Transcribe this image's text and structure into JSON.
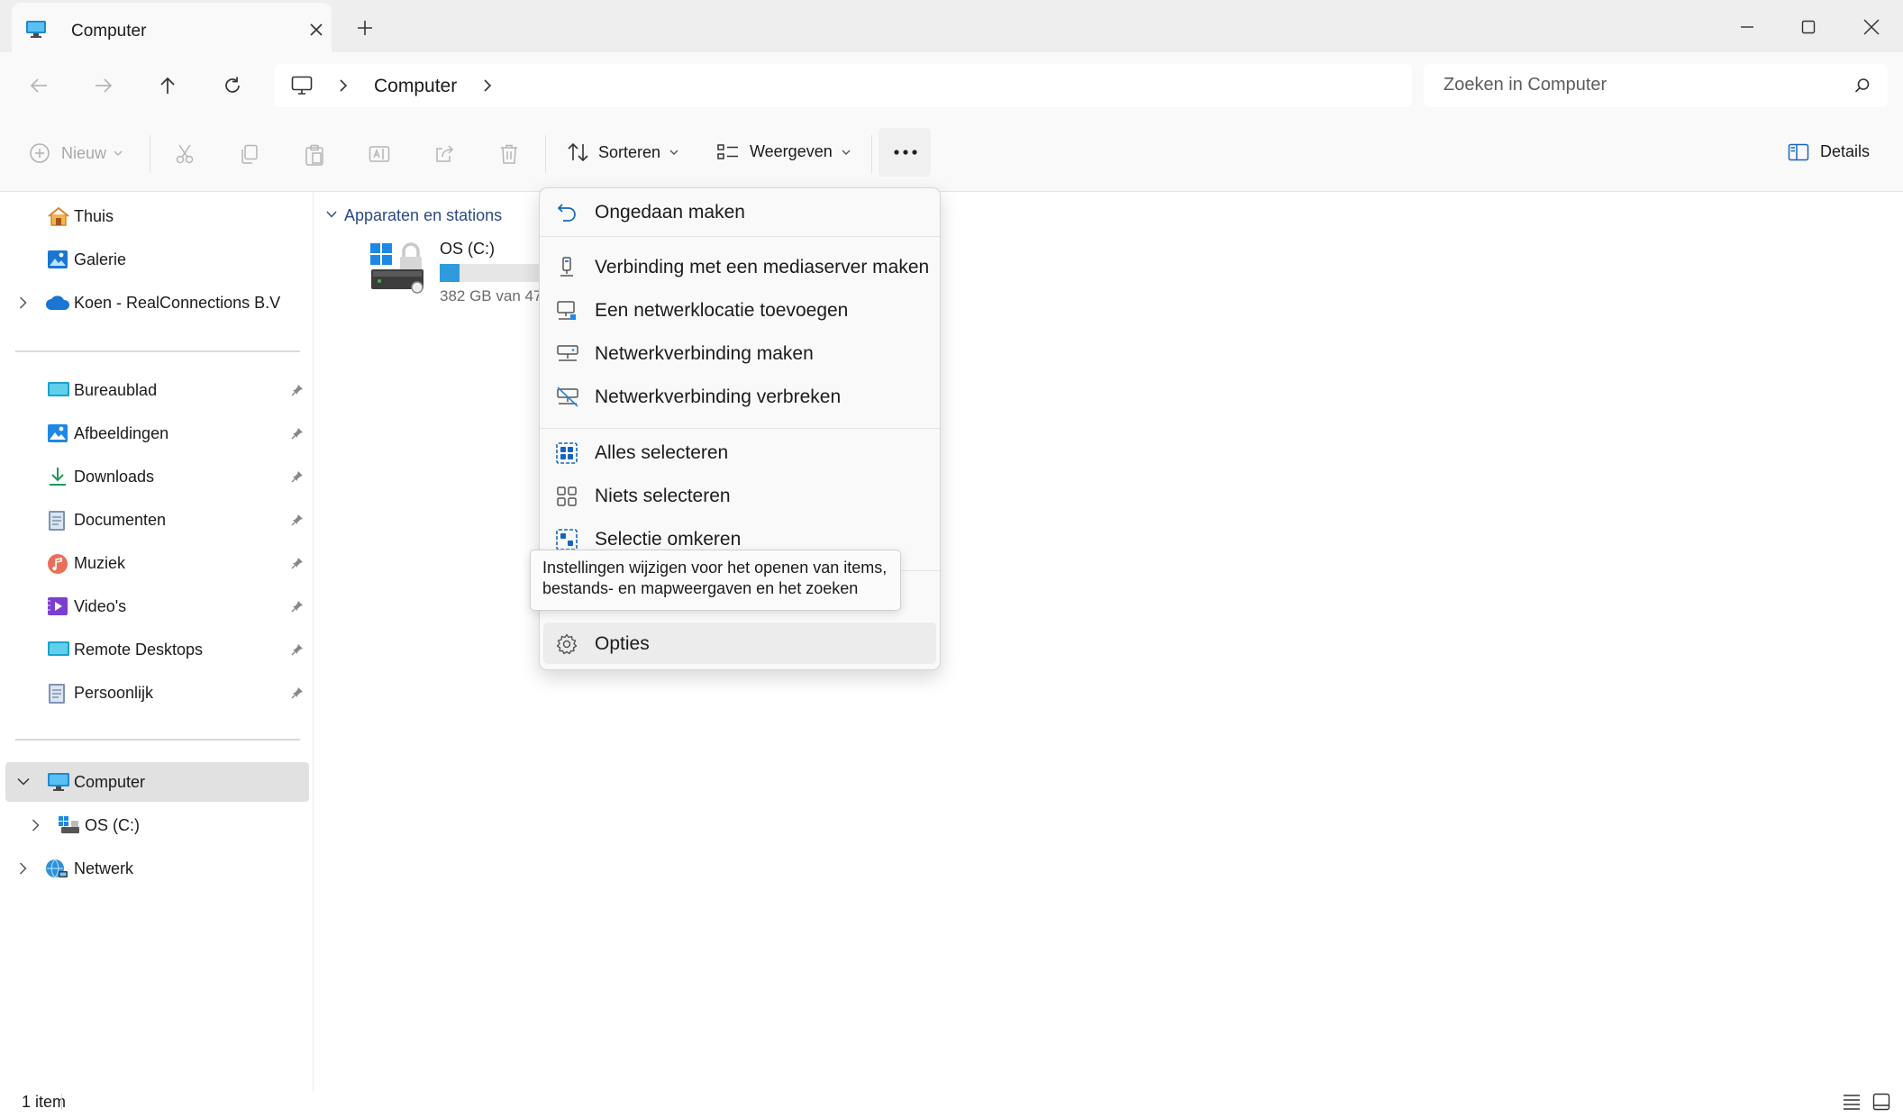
{
  "window": {
    "tab_title": "Computer",
    "controls": [
      "minimize",
      "maximize",
      "close"
    ]
  },
  "address_bar": {
    "breadcrumb": [
      "Computer"
    ],
    "search_placeholder": "Zoeken in Computer"
  },
  "toolbar": {
    "new_label": "Nieuw",
    "sort_label": "Sorteren",
    "view_label": "Weergeven",
    "details_label": "Details"
  },
  "sidebar": {
    "top_items": [
      {
        "label": "Thuis",
        "icon": "home-icon"
      },
      {
        "label": "Galerie",
        "icon": "gallery-icon"
      },
      {
        "label": "Koen - RealConnections B.V",
        "icon": "cloud-icon"
      }
    ],
    "pinned_items": [
      {
        "label": "Bureaublad",
        "icon": "desktop-folder-icon"
      },
      {
        "label": "Afbeeldingen",
        "icon": "pictures-folder-icon"
      },
      {
        "label": "Downloads",
        "icon": "download-icon"
      },
      {
        "label": "Documenten",
        "icon": "documents-icon"
      },
      {
        "label": "Muziek",
        "icon": "music-icon"
      },
      {
        "label": "Video's",
        "icon": "video-icon"
      },
      {
        "label": "Remote Desktops",
        "icon": "desktop-folder-icon"
      },
      {
        "label": "Persoonlijk",
        "icon": "documents-icon"
      }
    ],
    "tree_items": [
      {
        "label": "Computer",
        "icon": "computer-icon",
        "expanded": true,
        "selected": true
      },
      {
        "label": "OS (C:)",
        "icon": "drive-icon",
        "expanded": false
      },
      {
        "label": "Netwerk",
        "icon": "network-icon",
        "expanded": false
      }
    ]
  },
  "content": {
    "group_title": "Apparaten en stations",
    "drive": {
      "name": "OS (C:)",
      "usage_text": "382 GB van 47",
      "used_fraction": 0.2
    }
  },
  "context_menu": {
    "items": [
      {
        "label": "Ongedaan maken",
        "icon": "undo-icon"
      },
      {
        "label": "Verbinding met een mediaserver maken",
        "icon": "media-server-icon"
      },
      {
        "label": "Een netwerklocatie toevoegen",
        "icon": "network-location-icon"
      },
      {
        "label": "Netwerkverbinding maken",
        "icon": "map-network-drive-icon"
      },
      {
        "label": "Netwerkverbinding verbreken",
        "icon": "disconnect-network-drive-icon"
      },
      {
        "label": "Alles selecteren",
        "icon": "select-all-icon"
      },
      {
        "label": "Niets selecteren",
        "icon": "select-none-icon"
      },
      {
        "label": "Selectie omkeren",
        "icon": "invert-selection-icon"
      },
      {
        "label": "Opties",
        "icon": "gear-icon"
      }
    ]
  },
  "tooltip": {
    "line1": "Instellingen wijzigen voor het openen van items,",
    "line2": "bestands- en mapweergaven en het zoeken"
  },
  "status_bar": {
    "item_count": "1 item"
  }
}
